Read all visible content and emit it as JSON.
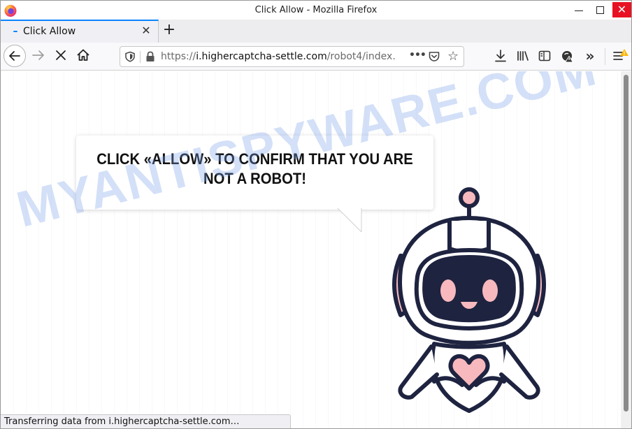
{
  "window": {
    "title": "Click Allow - Mozilla Firefox",
    "controls": {
      "minimize": "minimize",
      "maximize": "maximize",
      "close": "✕"
    }
  },
  "tabs": [
    {
      "title": "Click Allow",
      "state": "loading",
      "close": "✕"
    }
  ],
  "new_tab_label": "+",
  "navigation": {
    "back": "←",
    "forward": "→",
    "stop": "✕",
    "home": "home",
    "url": {
      "scheme": "https://",
      "host": "i.highercaptcha-settle.com",
      "path": "/robot4/index.",
      "full": "https://i.highercaptcha-settle.com/robot4/index."
    },
    "page_actions": "•••",
    "star": "☆"
  },
  "toolbar": {
    "icons": [
      "download-icon",
      "library-icon",
      "sidebar-icon",
      "tracking-protection-icon",
      "overflow-icon",
      "menu-icon"
    ],
    "overflow": "»",
    "menu_alert": "!"
  },
  "page": {
    "message": "CLICK «ALLOW» TO CONFIRM THAT YOU ARE NOT A ROBOT!",
    "watermark": "MYANTISPYWARE.COM",
    "colors": {
      "robot_outline": "#1e2340",
      "robot_accent": "#f7b9bd",
      "watermark": "#a9c3f0"
    }
  },
  "status": {
    "text": "Transferring data from i.highercaptcha-settle.com…"
  }
}
